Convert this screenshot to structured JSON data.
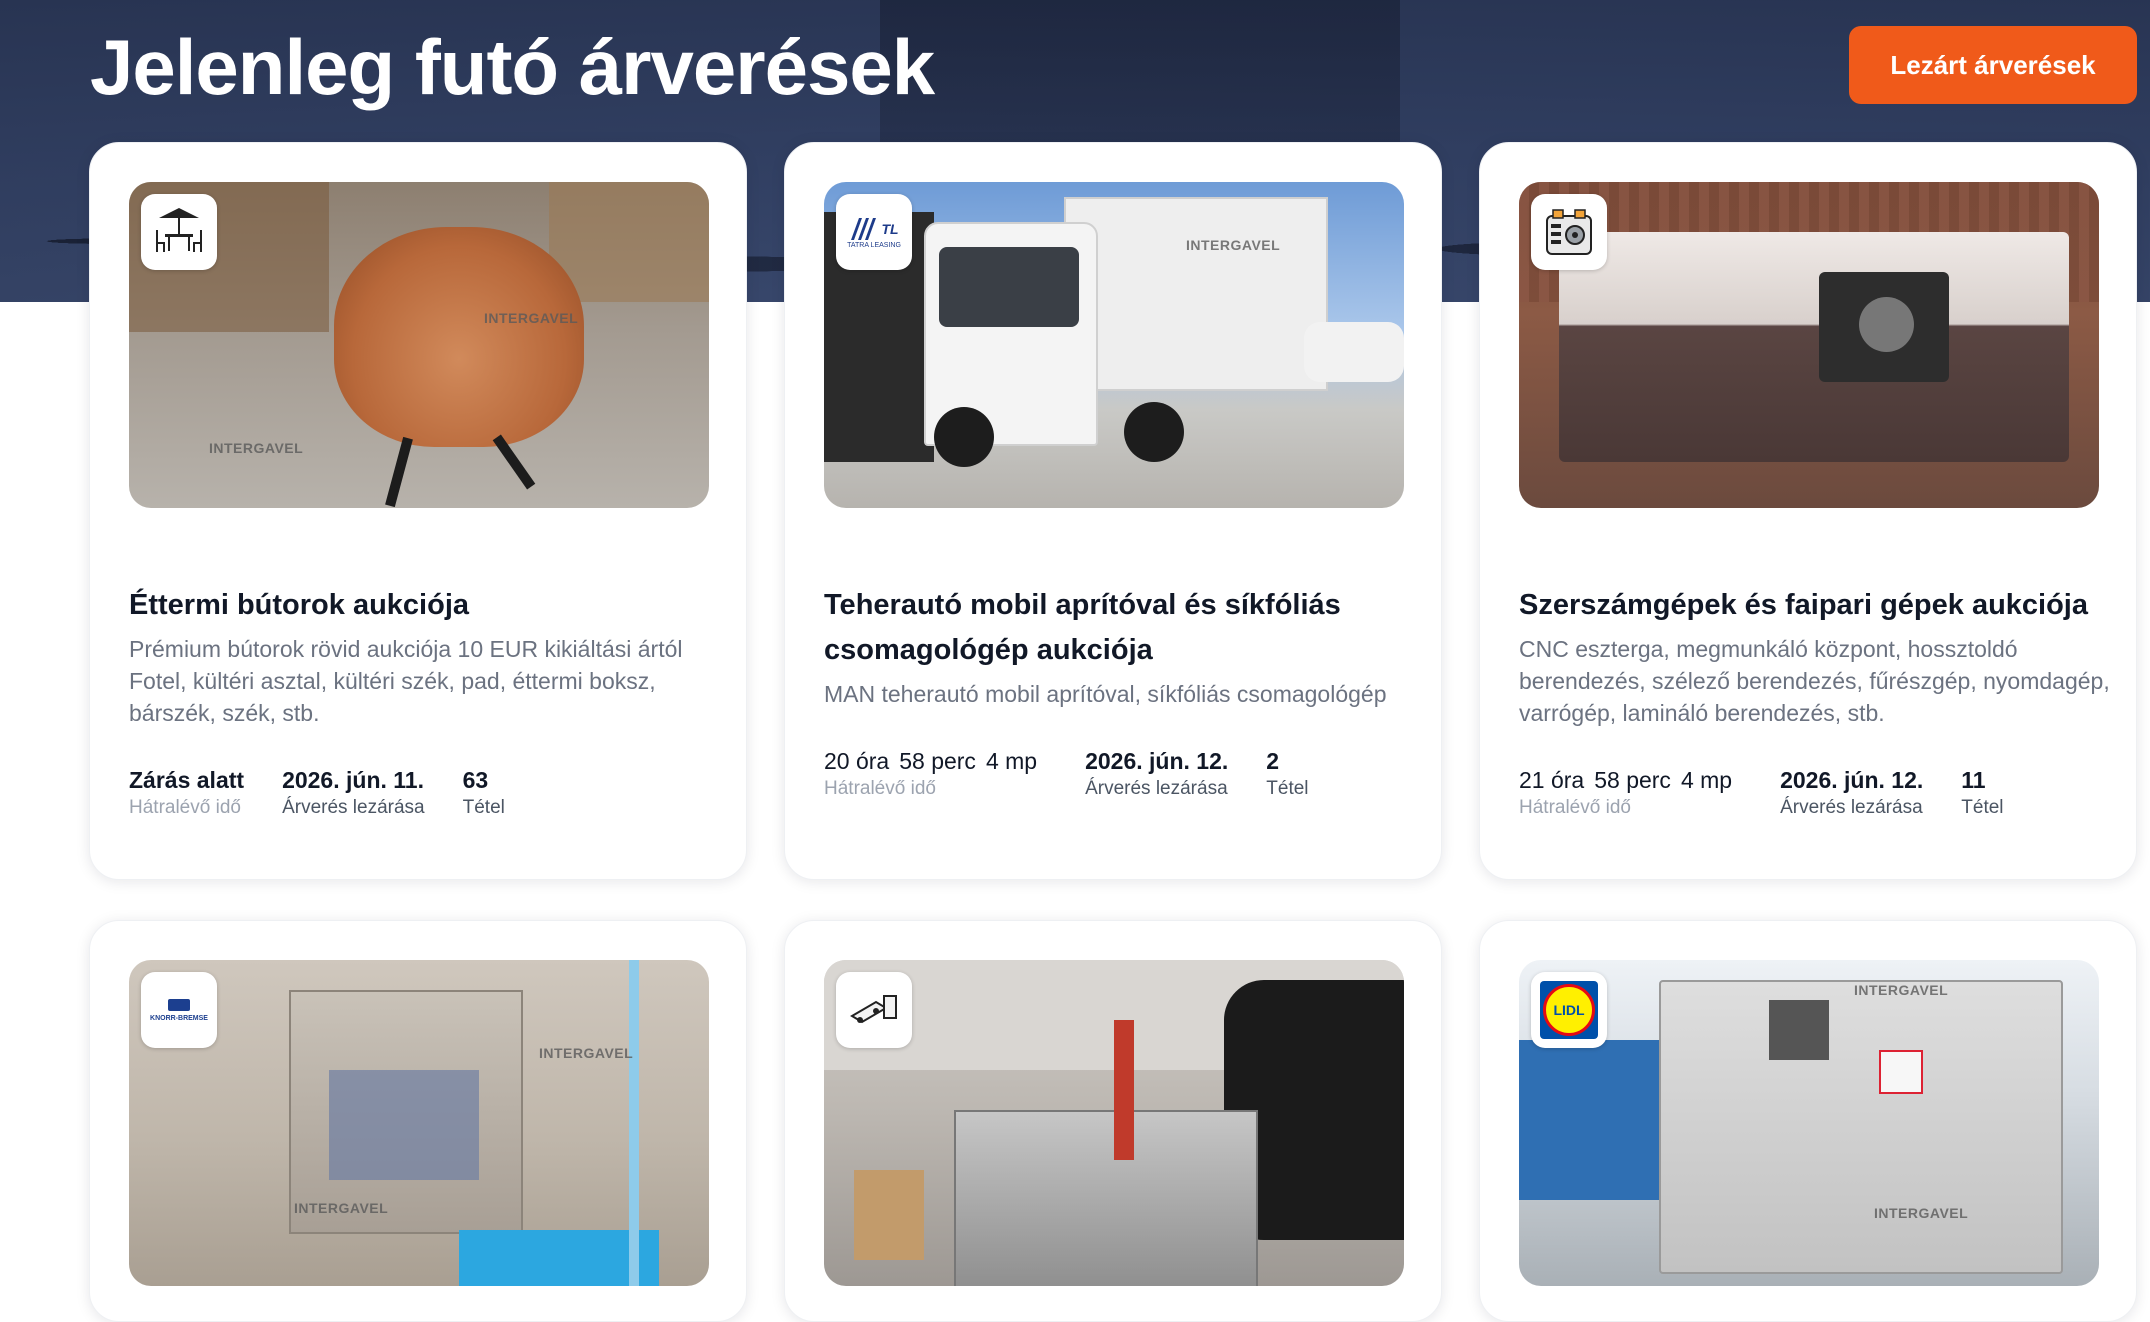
{
  "page": {
    "title": "Jelenleg futó árverések",
    "closed_button": "Lezárt árverések"
  },
  "colors": {
    "accent": "#f05a1a",
    "hero": "#303e60"
  },
  "watermark_text": "INTERGAVEL",
  "auctions": [
    {
      "title": "Éttermi bútorok aukciója",
      "description": "Prémium bútorok rövid aukciója 10 EUR kikiáltási ártól Fotel, kültéri asztal, kültéri szék, pad, éttermi boksz, bárszék, szék, stb.",
      "remaining": "Zárás alatt",
      "remaining_label": "Hátralévő idő",
      "close_date": "2026. jún. 11.",
      "close_label": "Árverés lezárása",
      "items": "63",
      "items_label": "Tétel",
      "logo_icon": "restaurant-table-icon"
    },
    {
      "title": "Teherautó mobil aprítóval és síkfóliás csomagológép aukciója",
      "description": "MAN teherautó mobil aprítóval, síkfóliás csomagológép",
      "remaining_parts": [
        "20 óra",
        "58 perc",
        "4 mp"
      ],
      "remaining_label": "Hátralévő idő",
      "close_date": "2026. jún. 12.",
      "close_label": "Árverés lezárása",
      "items": "2",
      "items_label": "Tétel",
      "logo_text": "TL",
      "logo_sub": "TATRA LEASING",
      "logo_icon": "tatra-leasing-logo"
    },
    {
      "title": "Szerszámgépek és faipari gépek aukciója",
      "description": "CNC eszterga, megmunkáló központ, hossztoldó berendezés, szélező berendezés, fűrészgép, nyomdagép, varrógép, lamináló berendezés, stb.",
      "remaining_parts": [
        "21 óra",
        "58 perc",
        "4 mp"
      ],
      "remaining_label": "Hátralévő idő",
      "close_date": "2026. jún. 12.",
      "close_label": "Árverés lezárása",
      "items": "11",
      "items_label": "Tétel",
      "logo_icon": "machine-gear-icon"
    },
    {
      "logo_text": "KNORR-BREMSE",
      "logo_icon": "knorr-bremse-logo"
    },
    {
      "logo_icon": "conveyor-machine-icon"
    },
    {
      "logo_text": "LIDL",
      "logo_icon": "lidl-logo"
    }
  ]
}
